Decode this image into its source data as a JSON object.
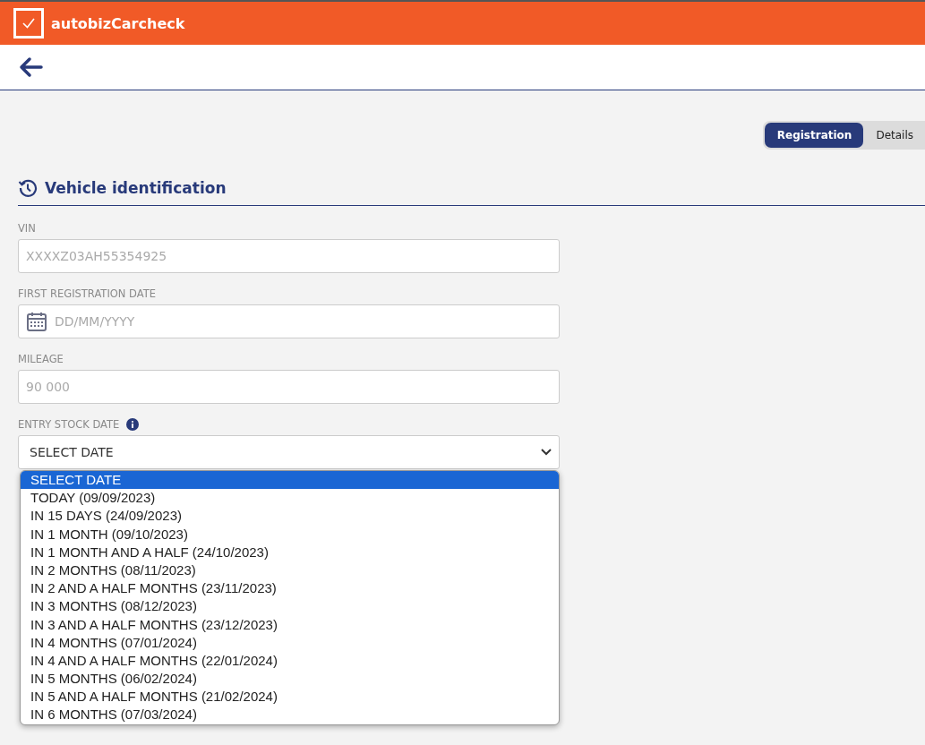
{
  "app": {
    "title": "autobizCarcheck"
  },
  "tabs": [
    {
      "label": "Registration",
      "selected": true
    },
    {
      "label": "Details",
      "selected": false
    }
  ],
  "section": {
    "title": "Vehicle identification"
  },
  "fields": [
    {
      "kind": "text",
      "label": "VIN",
      "placeholder": "XXXXZ03AH55354925"
    },
    {
      "kind": "date",
      "label": "FIRST REGISTRATION DATE",
      "placeholder": "DD/MM/YYYY"
    },
    {
      "kind": "text",
      "label": "MILEAGE",
      "placeholder": "90 000"
    },
    {
      "kind": "select",
      "label": "ENTRY STOCK DATE",
      "info": true,
      "value": "SELECT DATE",
      "expanded": true,
      "options": [
        {
          "label": "SELECT DATE",
          "selected": true
        },
        {
          "label": "TODAY (09/09/2023)",
          "selected": false
        },
        {
          "label": "IN 15 DAYS (24/09/2023)",
          "selected": false
        },
        {
          "label": "IN 1 MONTH (09/10/2023)",
          "selected": false
        },
        {
          "label": "IN 1 MONTH AND A HALF (24/10/2023)",
          "selected": false
        },
        {
          "label": "IN 2 MONTHS (08/11/2023)",
          "selected": false
        },
        {
          "label": "IN 2 AND A HALF MONTHS (23/11/2023)",
          "selected": false
        },
        {
          "label": "IN 3 MONTHS (08/12/2023)",
          "selected": false
        },
        {
          "label": "IN 3 AND A HALF MONTHS (23/12/2023)",
          "selected": false
        },
        {
          "label": "IN 4 MONTHS (07/01/2024)",
          "selected": false
        },
        {
          "label": "IN 4 AND A HALF MONTHS (22/01/2024)",
          "selected": false
        },
        {
          "label": "IN 5 MONTHS (06/02/2024)",
          "selected": false
        },
        {
          "label": "IN 5 AND A HALF MONTHS (21/02/2024)",
          "selected": false
        },
        {
          "label": "IN 6 MONTHS (07/03/2024)",
          "selected": false
        }
      ]
    }
  ]
}
